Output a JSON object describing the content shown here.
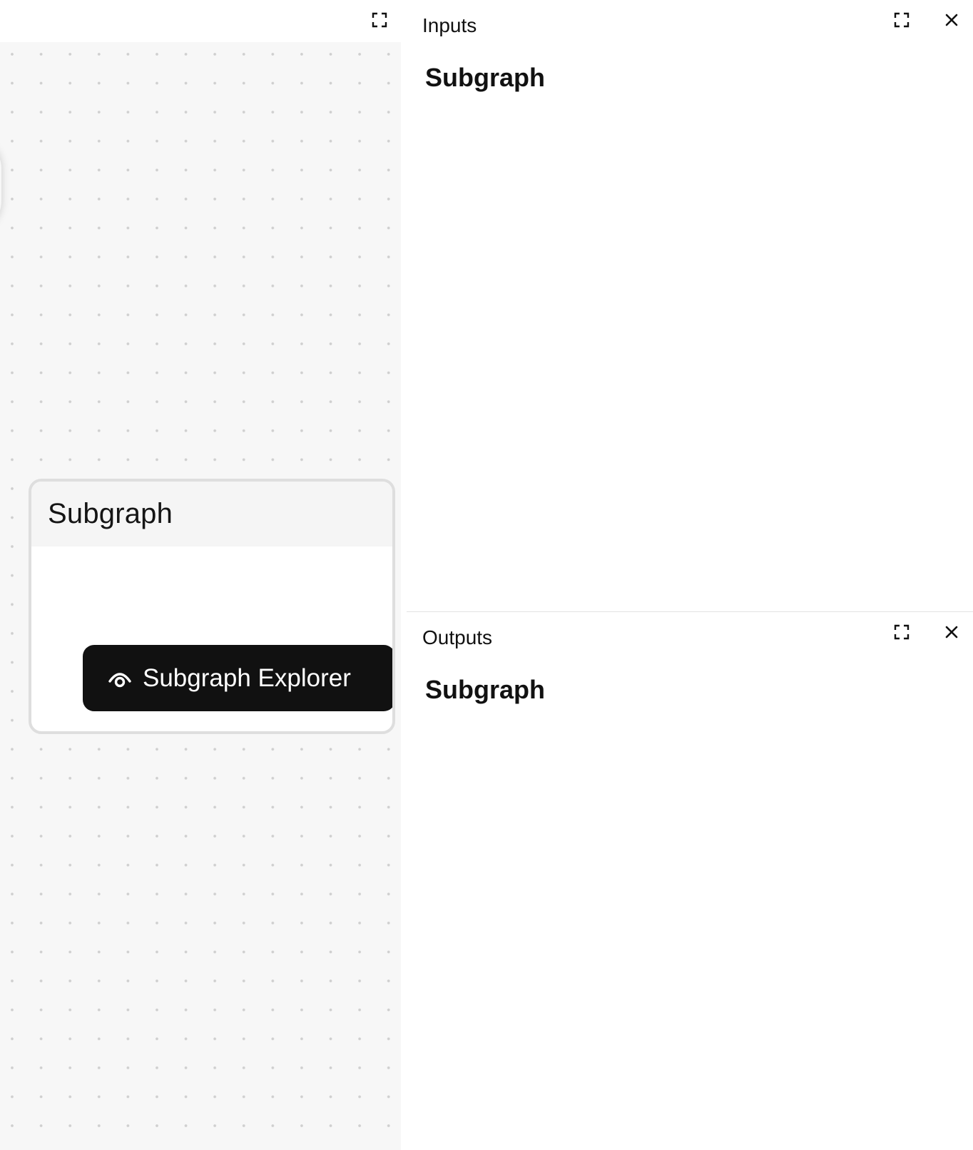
{
  "canvas": {
    "node": {
      "title": "Subgraph",
      "explorer_button_label": "Subgraph Explorer"
    }
  },
  "inputs_panel": {
    "label": "Inputs",
    "heading": "Subgraph"
  },
  "outputs_panel": {
    "label": "Outputs",
    "heading": "Subgraph"
  },
  "icons": {
    "expand": "expand-icon",
    "close": "close-icon",
    "eye": "eye-icon"
  }
}
